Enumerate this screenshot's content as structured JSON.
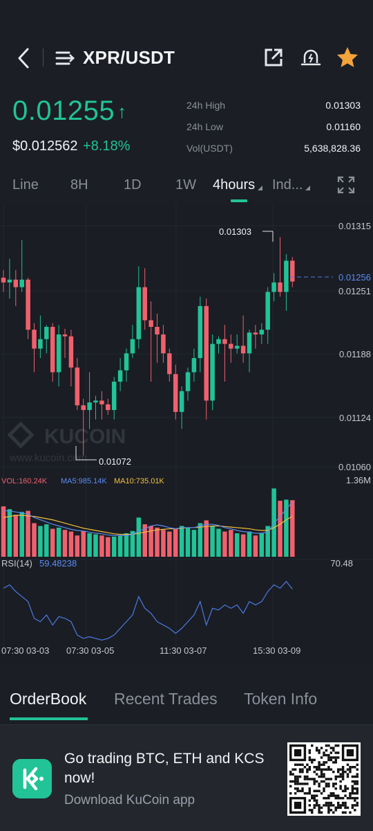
{
  "header": {
    "pair": "XPR/USDT"
  },
  "ticker": {
    "last_price": "0.01255",
    "arrow": "↑",
    "fiat_price": "$0.012562",
    "change": "+8.18%",
    "stats": [
      {
        "label": "24h High",
        "value": "0.01303"
      },
      {
        "label": "24h Low",
        "value": "0.01160"
      },
      {
        "label": "Vol(USDT)",
        "value": "5,638,828.36"
      }
    ]
  },
  "intervals": [
    "Line",
    "8H",
    "1D",
    "1W",
    "4hours",
    "Ind..."
  ],
  "tabs": [
    "OrderBook",
    "Recent Trades",
    "Token Info"
  ],
  "promo": {
    "title": "Go trading BTC, ETH and KCS now!",
    "subtitle": "Download KuCoin app"
  },
  "colors": {
    "up": "#21c397",
    "down": "#f0616d",
    "accent": "#21c397",
    "star": "#f3a33b"
  },
  "chart_data": {
    "type": "candlestick",
    "price_axis": [
      "0.01315",
      "0.01251",
      "0.01188",
      "0.01124",
      "0.01060"
    ],
    "current_price_label": "0.01256",
    "high_marker": "0.01303",
    "low_marker": "0.01072",
    "watermark": "KUCOIN",
    "watermark_url": "www.kucoin.com",
    "ylim": [
      0.0106,
      0.01315
    ],
    "candles": [
      {
        "o": 0.0126,
        "h": 0.01268,
        "l": 0.01245,
        "c": 0.01255
      },
      {
        "o": 0.01255,
        "h": 0.0128,
        "l": 0.01238,
        "c": 0.01258
      },
      {
        "o": 0.01258,
        "h": 0.01268,
        "l": 0.0123,
        "c": 0.0125
      },
      {
        "o": 0.0125,
        "h": 0.013,
        "l": 0.01245,
        "c": 0.01258
      },
      {
        "o": 0.01258,
        "h": 0.0126,
        "l": 0.01195,
        "c": 0.01205
      },
      {
        "o": 0.01205,
        "h": 0.01212,
        "l": 0.0116,
        "c": 0.01185
      },
      {
        "o": 0.01185,
        "h": 0.0122,
        "l": 0.01175,
        "c": 0.01195
      },
      {
        "o": 0.01195,
        "h": 0.0121,
        "l": 0.0118,
        "c": 0.01208
      },
      {
        "o": 0.01208,
        "h": 0.01212,
        "l": 0.0115,
        "c": 0.0116
      },
      {
        "o": 0.0116,
        "h": 0.0121,
        "l": 0.01145,
        "c": 0.012
      },
      {
        "o": 0.012,
        "h": 0.01206,
        "l": 0.01175,
        "c": 0.01198
      },
      {
        "o": 0.01198,
        "h": 0.01205,
        "l": 0.01145,
        "c": 0.01165
      },
      {
        "o": 0.01165,
        "h": 0.01175,
        "l": 0.0112,
        "c": 0.01125
      },
      {
        "o": 0.01125,
        "h": 0.01132,
        "l": 0.01072,
        "c": 0.0112
      },
      {
        "o": 0.0112,
        "h": 0.0116,
        "l": 0.011,
        "c": 0.01128
      },
      {
        "o": 0.01128,
        "h": 0.01135,
        "l": 0.0111,
        "c": 0.0113
      },
      {
        "o": 0.0113,
        "h": 0.0114,
        "l": 0.0111,
        "c": 0.01126
      },
      {
        "o": 0.01126,
        "h": 0.01132,
        "l": 0.01115,
        "c": 0.0112
      },
      {
        "o": 0.0112,
        "h": 0.01155,
        "l": 0.0111,
        "c": 0.0115
      },
      {
        "o": 0.0115,
        "h": 0.01175,
        "l": 0.0114,
        "c": 0.01162
      },
      {
        "o": 0.01162,
        "h": 0.01185,
        "l": 0.0115,
        "c": 0.0118
      },
      {
        "o": 0.0118,
        "h": 0.0121,
        "l": 0.01175,
        "c": 0.01195
      },
      {
        "o": 0.01195,
        "h": 0.01272,
        "l": 0.01185,
        "c": 0.0125
      },
      {
        "o": 0.0125,
        "h": 0.0127,
        "l": 0.01205,
        "c": 0.01215
      },
      {
        "o": 0.01215,
        "h": 0.01235,
        "l": 0.0115,
        "c": 0.01208
      },
      {
        "o": 0.01208,
        "h": 0.01222,
        "l": 0.0117,
        "c": 0.012
      },
      {
        "o": 0.012,
        "h": 0.0121,
        "l": 0.0117,
        "c": 0.0118
      },
      {
        "o": 0.0118,
        "h": 0.01185,
        "l": 0.0115,
        "c": 0.01158
      },
      {
        "o": 0.01158,
        "h": 0.01168,
        "l": 0.0111,
        "c": 0.01118
      },
      {
        "o": 0.01118,
        "h": 0.01145,
        "l": 0.011,
        "c": 0.0114
      },
      {
        "o": 0.0114,
        "h": 0.01165,
        "l": 0.0113,
        "c": 0.0116
      },
      {
        "o": 0.0116,
        "h": 0.01185,
        "l": 0.0115,
        "c": 0.01175
      },
      {
        "o": 0.01175,
        "h": 0.0124,
        "l": 0.0116,
        "c": 0.0123
      },
      {
        "o": 0.0123,
        "h": 0.01238,
        "l": 0.0111,
        "c": 0.0113
      },
      {
        "o": 0.0113,
        "h": 0.012,
        "l": 0.0112,
        "c": 0.0119
      },
      {
        "o": 0.0119,
        "h": 0.01198,
        "l": 0.0118,
        "c": 0.01195
      },
      {
        "o": 0.01195,
        "h": 0.0121,
        "l": 0.0115,
        "c": 0.0119
      },
      {
        "o": 0.0119,
        "h": 0.012,
        "l": 0.0117,
        "c": 0.01185
      },
      {
        "o": 0.01185,
        "h": 0.012,
        "l": 0.0118,
        "c": 0.01188
      },
      {
        "o": 0.01188,
        "h": 0.0122,
        "l": 0.0117,
        "c": 0.0118
      },
      {
        "o": 0.0118,
        "h": 0.01205,
        "l": 0.0116,
        "c": 0.01202
      },
      {
        "o": 0.01202,
        "h": 0.0121,
        "l": 0.01185,
        "c": 0.012
      },
      {
        "o": 0.012,
        "h": 0.01212,
        "l": 0.0119,
        "c": 0.01205
      },
      {
        "o": 0.01205,
        "h": 0.0125,
        "l": 0.0119,
        "c": 0.01245
      },
      {
        "o": 0.01245,
        "h": 0.01265,
        "l": 0.01235,
        "c": 0.01255
      },
      {
        "o": 0.01255,
        "h": 0.01303,
        "l": 0.0124,
        "c": 0.01245
      },
      {
        "o": 0.01245,
        "h": 0.01285,
        "l": 0.01225,
        "c": 0.01278
      },
      {
        "o": 0.01278,
        "h": 0.01282,
        "l": 0.0125,
        "c": 0.01256
      }
    ],
    "volume": {
      "labels": {
        "vol": "VOL:160.24K",
        "ma5": "MA5:985.14K",
        "ma10": "MA10:735.01K",
        "max": "1.36M"
      },
      "ylim": [
        0,
        1.36
      ],
      "values": [
        0.9,
        0.85,
        0.75,
        0.8,
        0.82,
        0.6,
        0.55,
        0.58,
        0.5,
        0.52,
        0.48,
        0.45,
        0.38,
        0.46,
        0.42,
        0.4,
        0.38,
        0.35,
        0.36,
        0.38,
        0.42,
        0.46,
        0.7,
        0.58,
        0.55,
        0.52,
        0.48,
        0.45,
        0.5,
        0.55,
        0.52,
        0.48,
        0.6,
        0.65,
        0.55,
        0.5,
        0.45,
        0.48,
        0.42,
        0.4,
        0.45,
        0.38,
        0.42,
        0.55,
        1.22,
        1.0,
        1.02,
        1.01
      ],
      "ma5": [
        0.82,
        0.82,
        0.8,
        0.78,
        0.76,
        0.7,
        0.66,
        0.62,
        0.58,
        0.55,
        0.52,
        0.49,
        0.47,
        0.46,
        0.44,
        0.42,
        0.41,
        0.39,
        0.38,
        0.38,
        0.38,
        0.4,
        0.46,
        0.5,
        0.55,
        0.57,
        0.55,
        0.52,
        0.5,
        0.52,
        0.52,
        0.52,
        0.55,
        0.58,
        0.58,
        0.56,
        0.52,
        0.5,
        0.47,
        0.45,
        0.44,
        0.42,
        0.42,
        0.44,
        0.6,
        0.72,
        0.85,
        0.98
      ],
      "ma10": [
        0.7,
        0.72,
        0.74,
        0.74,
        0.73,
        0.72,
        0.7,
        0.68,
        0.66,
        0.63,
        0.6,
        0.57,
        0.54,
        0.51,
        0.49,
        0.47,
        0.45,
        0.43,
        0.41,
        0.4,
        0.4,
        0.4,
        0.42,
        0.44,
        0.46,
        0.48,
        0.49,
        0.5,
        0.5,
        0.51,
        0.52,
        0.52,
        0.53,
        0.54,
        0.55,
        0.55,
        0.54,
        0.53,
        0.52,
        0.51,
        0.5,
        0.48,
        0.47,
        0.47,
        0.52,
        0.58,
        0.66,
        0.72
      ]
    },
    "rsi": {
      "label": "RSI(14)",
      "value_label": "59.48238",
      "max_label": "70.48",
      "ylim": [
        25,
        70.48
      ],
      "values": [
        60,
        62,
        58,
        55,
        52,
        42,
        40,
        44,
        38,
        43,
        42,
        40,
        32,
        30,
        31,
        30,
        29,
        30,
        32,
        36,
        40,
        44,
        55,
        48,
        45,
        40,
        38,
        36,
        33,
        36,
        40,
        44,
        52,
        38,
        48,
        47,
        50,
        48,
        50,
        45,
        52,
        50,
        52,
        58,
        62,
        60,
        64,
        59.48
      ]
    },
    "time_axis": [
      "07:30 03-03",
      "07:30 03-05",
      "11:30 03-07",
      "15:30 03-09"
    ]
  }
}
